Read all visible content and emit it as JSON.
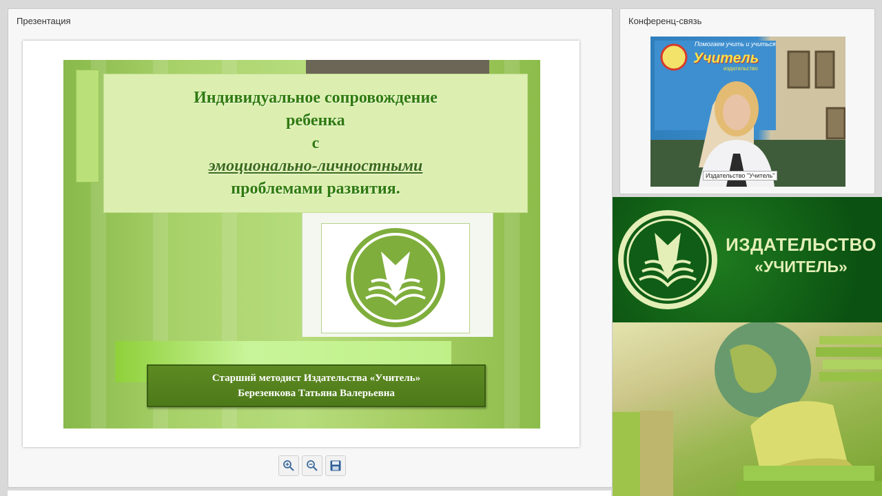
{
  "presentation_panel": {
    "title": "Презентация",
    "slide": {
      "title_lines": [
        "Индивидуальное сопровождение",
        "ребенка",
        "с",
        "эмоционально-личностными",
        "проблемами развития."
      ],
      "author_lines": [
        "Старший методист Издательства «Учитель»",
        "Березенкова Татьяна Валерьевна"
      ]
    },
    "toolbar": {
      "zoom_in_icon": "zoom-in-icon",
      "zoom_out_icon": "zoom-out-icon",
      "save_icon": "save-icon"
    }
  },
  "conference_panel": {
    "title": "Конференц-связь",
    "video": {
      "participant_label": "Издательство \"Учитель\"",
      "poster_tagline": "Помогаем учить и учиться",
      "poster_brand": "Учитель",
      "poster_sub": "издательство"
    }
  },
  "banner": {
    "line1": "ИЗДАТЕЛЬСТВО",
    "line2": "«УЧИТЕЛЬ»"
  },
  "colors": {
    "slide_green": "#a9d26b",
    "title_green": "#2f7a10",
    "banner_green": "#0b5212",
    "banner_text": "#e3efb7"
  }
}
